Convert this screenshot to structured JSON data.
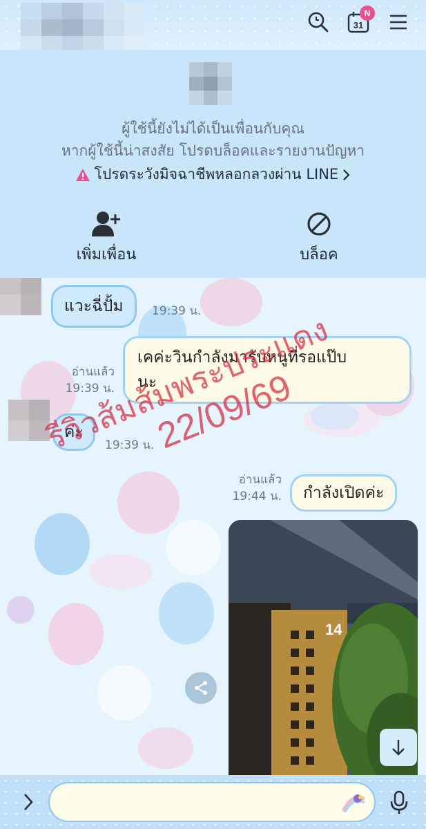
{
  "header": {
    "contact_name": "",
    "search_icon": "search-icon",
    "calendar_label": "31",
    "calendar_badge": "N",
    "menu_icon": "hamburger-menu-icon"
  },
  "stranger_panel": {
    "notice_line1": "ผู้ใช้นี้ยังไม่ได้เป็นเพื่อนกับคุณ",
    "notice_line2": "หากผู้ใช้นี้น่าสงสัย โปรดบล็อคและรายงานปัญหา",
    "warning_text": "โปรดระวังมิจฉาชีพหลอกลวงผ่าน LINE",
    "warning_color": "#e94e8f",
    "add_friend_label": "เพิ่มเพื่อน",
    "block_label": "บล็อค"
  },
  "messages": [
    {
      "direction": "in",
      "text": "แวะฉี่ปั้ม",
      "time": "19:39 น."
    },
    {
      "direction": "out",
      "line1": "เคค่ะวินกำลังมารับหนูที่รอแป๊บ",
      "line2": "นะ",
      "read": "อ่านแล้ว",
      "time": "19:39 น."
    },
    {
      "direction": "in",
      "text": "ค่ะ",
      "time": "19:39 น."
    },
    {
      "direction": "out",
      "text": "กำลังเปิดค่ะ",
      "read": "อ่านแล้ว",
      "time": "19:44 น."
    }
  ],
  "photo": {
    "door_number": "14"
  },
  "watermark": {
    "line1": "รีวิวส้มส้มพระประแดง",
    "line2": "22/09/69",
    "color": "#d7283c"
  },
  "input": {
    "placeholder": ""
  },
  "colors": {
    "bubble_border": "#8cc9f4",
    "chat_bg": "#e6f4fd",
    "header_bg": "#cfe8fb"
  }
}
